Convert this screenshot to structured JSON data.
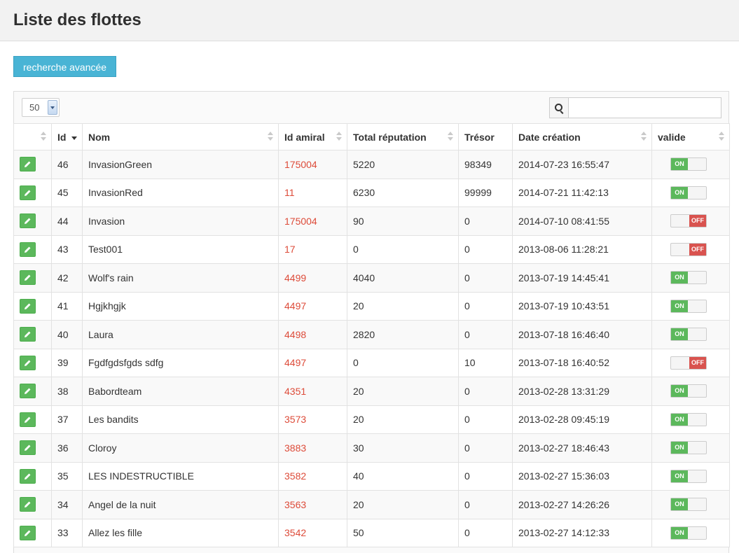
{
  "header": {
    "title": "Liste des flottes"
  },
  "toolbar": {
    "advanced_search_label": "recherche avancée"
  },
  "table_controls": {
    "page_length": "50",
    "search_value": ""
  },
  "table": {
    "columns": [
      "",
      "Id",
      "Nom",
      "Id amiral",
      "Total réputation",
      "Trésor",
      "Date création",
      "valide"
    ],
    "sorted_column": "Id",
    "sort_direction": "desc",
    "rows": [
      {
        "id": "46",
        "nom": "InvasionGreen",
        "id_amiral": "175004",
        "reputation": "5220",
        "tresor": "98349",
        "date": "2014-07-23 16:55:47",
        "valide": "ON"
      },
      {
        "id": "45",
        "nom": "InvasionRed",
        "id_amiral": "11",
        "reputation": "6230",
        "tresor": "99999",
        "date": "2014-07-21 11:42:13",
        "valide": "ON"
      },
      {
        "id": "44",
        "nom": "Invasion",
        "id_amiral": "175004",
        "reputation": "90",
        "tresor": "0",
        "date": "2014-07-10 08:41:55",
        "valide": "OFF"
      },
      {
        "id": "43",
        "nom": "Test001",
        "id_amiral": "17",
        "reputation": "0",
        "tresor": "0",
        "date": "2013-08-06 11:28:21",
        "valide": "OFF"
      },
      {
        "id": "42",
        "nom": "Wolf's rain",
        "id_amiral": "4499",
        "reputation": "4040",
        "tresor": "0",
        "date": "2013-07-19 14:45:41",
        "valide": "ON"
      },
      {
        "id": "41",
        "nom": "Hgjkhgjk",
        "id_amiral": "4497",
        "reputation": "20",
        "tresor": "0",
        "date": "2013-07-19 10:43:51",
        "valide": "ON"
      },
      {
        "id": "40",
        "nom": "Laura",
        "id_amiral": "4498",
        "reputation": "2820",
        "tresor": "0",
        "date": "2013-07-18 16:46:40",
        "valide": "ON"
      },
      {
        "id": "39",
        "nom": "Fgdfgdsfgds sdfg",
        "id_amiral": "4497",
        "reputation": "0",
        "tresor": "10",
        "date": "2013-07-18 16:40:52",
        "valide": "OFF"
      },
      {
        "id": "38",
        "nom": "Babordteam",
        "id_amiral": "4351",
        "reputation": "20",
        "tresor": "0",
        "date": "2013-02-28 13:31:29",
        "valide": "ON"
      },
      {
        "id": "37",
        "nom": "Les bandits",
        "id_amiral": "3573",
        "reputation": "20",
        "tresor": "0",
        "date": "2013-02-28 09:45:19",
        "valide": "ON"
      },
      {
        "id": "36",
        "nom": "Cloroy",
        "id_amiral": "3883",
        "reputation": "30",
        "tresor": "0",
        "date": "2013-02-27 18:46:43",
        "valide": "ON"
      },
      {
        "id": "35",
        "nom": "LES INDESTRUCTIBLE",
        "id_amiral": "3582",
        "reputation": "40",
        "tresor": "0",
        "date": "2013-02-27 15:36:03",
        "valide": "ON"
      },
      {
        "id": "34",
        "nom": "Angel de la nuit",
        "id_amiral": "3563",
        "reputation": "20",
        "tresor": "0",
        "date": "2013-02-27 14:26:26",
        "valide": "ON"
      },
      {
        "id": "33",
        "nom": "Allez les fille",
        "id_amiral": "3542",
        "reputation": "50",
        "tresor": "0",
        "date": "2013-02-27 14:12:33",
        "valide": "ON"
      }
    ]
  },
  "colors": {
    "accent_blue": "#49b4d5",
    "link_red": "#dd4b39",
    "on_green": "#5cb85c",
    "off_red": "#d9534f"
  },
  "icons": {
    "edit": "pencil-icon",
    "search": "search-icon"
  }
}
